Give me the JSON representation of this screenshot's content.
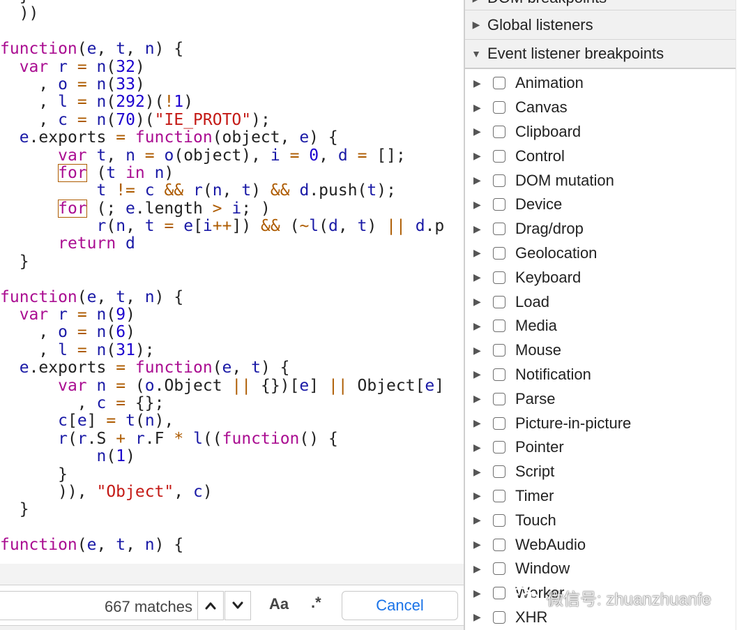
{
  "editor": {
    "code_lines": [
      [
        {
          "t": "  }"
        }
      ],
      [
        {
          "t": "  ))"
        }
      ],
      [
        {
          "t": ""
        }
      ],
      [
        {
          "t": "function",
          "c": "kw"
        },
        {
          "t": "("
        },
        {
          "t": "e",
          "c": "id"
        },
        {
          "t": ", "
        },
        {
          "t": "t",
          "c": "id"
        },
        {
          "t": ", "
        },
        {
          "t": "n",
          "c": "id"
        },
        {
          "t": ") {"
        }
      ],
      [
        {
          "t": "  "
        },
        {
          "t": "var",
          "c": "kw"
        },
        {
          "t": " "
        },
        {
          "t": "r",
          "c": "id"
        },
        {
          "t": " "
        },
        {
          "t": "=",
          "c": "op"
        },
        {
          "t": " "
        },
        {
          "t": "n",
          "c": "id"
        },
        {
          "t": "("
        },
        {
          "t": "32",
          "c": "num"
        },
        {
          "t": ")"
        }
      ],
      [
        {
          "t": "    , "
        },
        {
          "t": "o",
          "c": "id"
        },
        {
          "t": " "
        },
        {
          "t": "=",
          "c": "op"
        },
        {
          "t": " "
        },
        {
          "t": "n",
          "c": "id"
        },
        {
          "t": "("
        },
        {
          "t": "33",
          "c": "num"
        },
        {
          "t": ")"
        }
      ],
      [
        {
          "t": "    , "
        },
        {
          "t": "l",
          "c": "id"
        },
        {
          "t": " "
        },
        {
          "t": "=",
          "c": "op"
        },
        {
          "t": " "
        },
        {
          "t": "n",
          "c": "id"
        },
        {
          "t": "("
        },
        {
          "t": "292",
          "c": "num"
        },
        {
          "t": ")("
        },
        {
          "t": "!",
          "c": "op"
        },
        {
          "t": "1",
          "c": "num"
        },
        {
          "t": ")"
        }
      ],
      [
        {
          "t": "    , "
        },
        {
          "t": "c",
          "c": "id"
        },
        {
          "t": " "
        },
        {
          "t": "=",
          "c": "op"
        },
        {
          "t": " "
        },
        {
          "t": "n",
          "c": "id"
        },
        {
          "t": "("
        },
        {
          "t": "70",
          "c": "num"
        },
        {
          "t": ")("
        },
        {
          "t": "\"IE_PROTO\"",
          "c": "str"
        },
        {
          "t": ");"
        }
      ],
      [
        {
          "t": "  "
        },
        {
          "t": "e",
          "c": "id"
        },
        {
          "t": ".exports "
        },
        {
          "t": "=",
          "c": "op"
        },
        {
          "t": " "
        },
        {
          "t": "function",
          "c": "kw"
        },
        {
          "t": "(object, "
        },
        {
          "t": "e",
          "c": "id"
        },
        {
          "t": ") {"
        }
      ],
      [
        {
          "t": "      "
        },
        {
          "t": "var",
          "c": "kw"
        },
        {
          "t": " "
        },
        {
          "t": "t",
          "c": "id"
        },
        {
          "t": ", "
        },
        {
          "t": "n",
          "c": "id"
        },
        {
          "t": " "
        },
        {
          "t": "=",
          "c": "op"
        },
        {
          "t": " "
        },
        {
          "t": "o",
          "c": "id"
        },
        {
          "t": "(object), "
        },
        {
          "t": "i",
          "c": "id"
        },
        {
          "t": " "
        },
        {
          "t": "=",
          "c": "op"
        },
        {
          "t": " "
        },
        {
          "t": "0",
          "c": "num"
        },
        {
          "t": ", "
        },
        {
          "t": "d",
          "c": "id"
        },
        {
          "t": " "
        },
        {
          "t": "=",
          "c": "op"
        },
        {
          "t": " [];"
        }
      ],
      [
        {
          "t": "      "
        },
        {
          "t": "for",
          "c": "kw boxed"
        },
        {
          "t": " ("
        },
        {
          "t": "t",
          "c": "id"
        },
        {
          "t": " "
        },
        {
          "t": "in",
          "c": "kw"
        },
        {
          "t": " "
        },
        {
          "t": "n",
          "c": "id"
        },
        {
          "t": ")"
        }
      ],
      [
        {
          "t": "          "
        },
        {
          "t": "t",
          "c": "id"
        },
        {
          "t": " "
        },
        {
          "t": "!=",
          "c": "op"
        },
        {
          "t": " "
        },
        {
          "t": "c",
          "c": "id"
        },
        {
          "t": " "
        },
        {
          "t": "&&",
          "c": "op"
        },
        {
          "t": " "
        },
        {
          "t": "r",
          "c": "id"
        },
        {
          "t": "("
        },
        {
          "t": "n",
          "c": "id"
        },
        {
          "t": ", "
        },
        {
          "t": "t",
          "c": "id"
        },
        {
          "t": ") "
        },
        {
          "t": "&&",
          "c": "op"
        },
        {
          "t": " "
        },
        {
          "t": "d",
          "c": "id"
        },
        {
          "t": ".push("
        },
        {
          "t": "t",
          "c": "id"
        },
        {
          "t": ");"
        }
      ],
      [
        {
          "t": "      "
        },
        {
          "t": "for",
          "c": "kw boxed"
        },
        {
          "t": " (; "
        },
        {
          "t": "e",
          "c": "id"
        },
        {
          "t": ".length "
        },
        {
          "t": ">",
          "c": "op"
        },
        {
          "t": " "
        },
        {
          "t": "i",
          "c": "id"
        },
        {
          "t": "; )"
        }
      ],
      [
        {
          "t": "          "
        },
        {
          "t": "r",
          "c": "id"
        },
        {
          "t": "("
        },
        {
          "t": "n",
          "c": "id"
        },
        {
          "t": ", "
        },
        {
          "t": "t",
          "c": "id"
        },
        {
          "t": " "
        },
        {
          "t": "=",
          "c": "op"
        },
        {
          "t": " "
        },
        {
          "t": "e",
          "c": "id"
        },
        {
          "t": "["
        },
        {
          "t": "i",
          "c": "id"
        },
        {
          "t": "++",
          "c": "op"
        },
        {
          "t": "]) "
        },
        {
          "t": "&&",
          "c": "op"
        },
        {
          "t": " ("
        },
        {
          "t": "~",
          "c": "op"
        },
        {
          "t": "l",
          "c": "id"
        },
        {
          "t": "("
        },
        {
          "t": "d",
          "c": "id"
        },
        {
          "t": ", "
        },
        {
          "t": "t",
          "c": "id"
        },
        {
          "t": ") "
        },
        {
          "t": "||",
          "c": "op"
        },
        {
          "t": " "
        },
        {
          "t": "d",
          "c": "id"
        },
        {
          "t": ".p"
        }
      ],
      [
        {
          "t": "      "
        },
        {
          "t": "return",
          "c": "kw"
        },
        {
          "t": " "
        },
        {
          "t": "d",
          "c": "id"
        }
      ],
      [
        {
          "t": "  }"
        }
      ],
      [
        {
          "t": ""
        }
      ],
      [
        {
          "t": "function",
          "c": "kw"
        },
        {
          "t": "("
        },
        {
          "t": "e",
          "c": "id"
        },
        {
          "t": ", "
        },
        {
          "t": "t",
          "c": "id"
        },
        {
          "t": ", "
        },
        {
          "t": "n",
          "c": "id"
        },
        {
          "t": ") {"
        }
      ],
      [
        {
          "t": "  "
        },
        {
          "t": "var",
          "c": "kw"
        },
        {
          "t": " "
        },
        {
          "t": "r",
          "c": "id"
        },
        {
          "t": " "
        },
        {
          "t": "=",
          "c": "op"
        },
        {
          "t": " "
        },
        {
          "t": "n",
          "c": "id"
        },
        {
          "t": "("
        },
        {
          "t": "9",
          "c": "num"
        },
        {
          "t": ")"
        }
      ],
      [
        {
          "t": "    , "
        },
        {
          "t": "o",
          "c": "id"
        },
        {
          "t": " "
        },
        {
          "t": "=",
          "c": "op"
        },
        {
          "t": " "
        },
        {
          "t": "n",
          "c": "id"
        },
        {
          "t": "("
        },
        {
          "t": "6",
          "c": "num"
        },
        {
          "t": ")"
        }
      ],
      [
        {
          "t": "    , "
        },
        {
          "t": "l",
          "c": "id"
        },
        {
          "t": " "
        },
        {
          "t": "=",
          "c": "op"
        },
        {
          "t": " "
        },
        {
          "t": "n",
          "c": "id"
        },
        {
          "t": "("
        },
        {
          "t": "31",
          "c": "num"
        },
        {
          "t": ");"
        }
      ],
      [
        {
          "t": "  "
        },
        {
          "t": "e",
          "c": "id"
        },
        {
          "t": ".exports "
        },
        {
          "t": "=",
          "c": "op"
        },
        {
          "t": " "
        },
        {
          "t": "function",
          "c": "kw"
        },
        {
          "t": "("
        },
        {
          "t": "e",
          "c": "id"
        },
        {
          "t": ", "
        },
        {
          "t": "t",
          "c": "id"
        },
        {
          "t": ") {"
        }
      ],
      [
        {
          "t": "      "
        },
        {
          "t": "var",
          "c": "kw"
        },
        {
          "t": " "
        },
        {
          "t": "n",
          "c": "id"
        },
        {
          "t": " "
        },
        {
          "t": "=",
          "c": "op"
        },
        {
          "t": " ("
        },
        {
          "t": "o",
          "c": "id"
        },
        {
          "t": ".Object "
        },
        {
          "t": "||",
          "c": "op"
        },
        {
          "t": " {})["
        },
        {
          "t": "e",
          "c": "id"
        },
        {
          "t": "] "
        },
        {
          "t": "||",
          "c": "op"
        },
        {
          "t": " Object["
        },
        {
          "t": "e",
          "c": "id"
        },
        {
          "t": "]"
        }
      ],
      [
        {
          "t": "        , "
        },
        {
          "t": "c",
          "c": "id"
        },
        {
          "t": " "
        },
        {
          "t": "=",
          "c": "op"
        },
        {
          "t": " {};"
        }
      ],
      [
        {
          "t": "      "
        },
        {
          "t": "c",
          "c": "id"
        },
        {
          "t": "["
        },
        {
          "t": "e",
          "c": "id"
        },
        {
          "t": "] "
        },
        {
          "t": "=",
          "c": "op"
        },
        {
          "t": " "
        },
        {
          "t": "t",
          "c": "id"
        },
        {
          "t": "("
        },
        {
          "t": "n",
          "c": "id"
        },
        {
          "t": "),"
        }
      ],
      [
        {
          "t": "      "
        },
        {
          "t": "r",
          "c": "id"
        },
        {
          "t": "("
        },
        {
          "t": "r",
          "c": "id"
        },
        {
          "t": ".S "
        },
        {
          "t": "+",
          "c": "op"
        },
        {
          "t": " "
        },
        {
          "t": "r",
          "c": "id"
        },
        {
          "t": ".F "
        },
        {
          "t": "*",
          "c": "op"
        },
        {
          "t": " "
        },
        {
          "t": "l",
          "c": "id"
        },
        {
          "t": "(("
        },
        {
          "t": "function",
          "c": "kw"
        },
        {
          "t": "() {"
        }
      ],
      [
        {
          "t": "          "
        },
        {
          "t": "n",
          "c": "id"
        },
        {
          "t": "("
        },
        {
          "t": "1",
          "c": "num"
        },
        {
          "t": ")"
        }
      ],
      [
        {
          "t": "      }"
        }
      ],
      [
        {
          "t": "      )), "
        },
        {
          "t": "\"Object\"",
          "c": "str"
        },
        {
          "t": ", "
        },
        {
          "t": "c",
          "c": "id"
        },
        {
          "t": ")"
        }
      ],
      [
        {
          "t": "  }"
        }
      ],
      [
        {
          "t": ""
        }
      ],
      [
        {
          "t": "function",
          "c": "kw"
        },
        {
          "t": "("
        },
        {
          "t": "e",
          "c": "id"
        },
        {
          "t": ", "
        },
        {
          "t": "t",
          "c": "id"
        },
        {
          "t": ", "
        },
        {
          "t": "n",
          "c": "id"
        },
        {
          "t": ") {"
        }
      ]
    ]
  },
  "search": {
    "match_count": "667 matches",
    "prev_icon": "chevron-up-icon",
    "next_icon": "chevron-down-icon",
    "match_case_label": "Aa",
    "regex_label": ".*",
    "cancel_label": "Cancel"
  },
  "panel": {
    "dom_breakpoints_label": "DOM breakpoints",
    "global_listeners_label": "Global listeners",
    "event_listener_breakpoints_label": "Event listener breakpoints",
    "event_categories": [
      {
        "label": "Animation",
        "checked": false
      },
      {
        "label": "Canvas",
        "checked": false
      },
      {
        "label": "Clipboard",
        "checked": false
      },
      {
        "label": "Control",
        "checked": false
      },
      {
        "label": "DOM mutation",
        "checked": false
      },
      {
        "label": "Device",
        "checked": false
      },
      {
        "label": "Drag/drop",
        "checked": false
      },
      {
        "label": "Geolocation",
        "checked": false
      },
      {
        "label": "Keyboard",
        "checked": false
      },
      {
        "label": "Load",
        "checked": false
      },
      {
        "label": "Media",
        "checked": false
      },
      {
        "label": "Mouse",
        "checked": false
      },
      {
        "label": "Notification",
        "checked": false
      },
      {
        "label": "Parse",
        "checked": false
      },
      {
        "label": "Picture-in-picture",
        "checked": false
      },
      {
        "label": "Pointer",
        "checked": false
      },
      {
        "label": "Script",
        "checked": false
      },
      {
        "label": "Timer",
        "checked": false
      },
      {
        "label": "Touch",
        "checked": false
      },
      {
        "label": "WebAudio",
        "checked": false
      },
      {
        "label": "Window",
        "checked": false
      },
      {
        "label": "Worker",
        "checked": false
      },
      {
        "label": "XHR",
        "checked": false
      }
    ]
  },
  "watermark": {
    "text": "微信号: zhuanzhuanfe",
    "icon": "wechat-logo"
  },
  "colors": {
    "keyword": "#aa0d91",
    "number": "#1c00cf",
    "string": "#c41a16",
    "identifier": "#1a1aa6",
    "operator": "#ad5b00",
    "link_blue": "#1a73e8"
  }
}
